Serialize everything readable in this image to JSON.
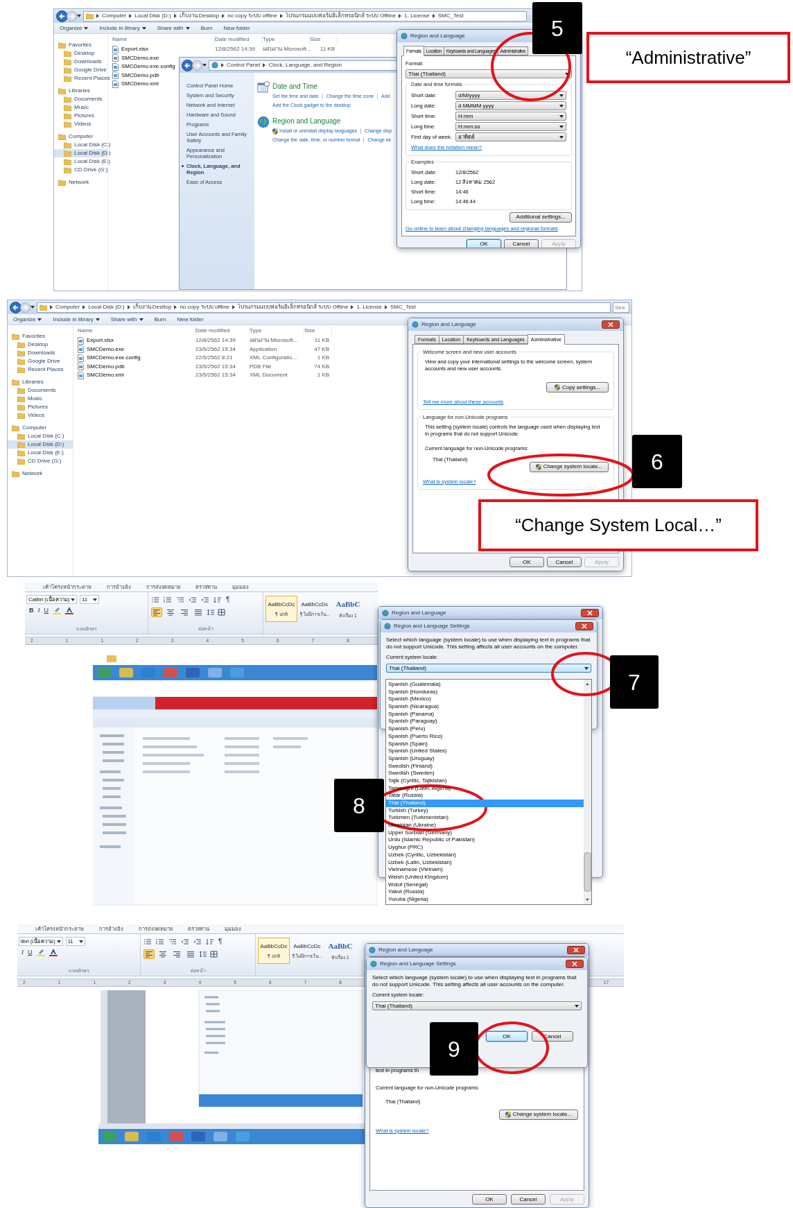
{
  "panel_1": {
    "explorer": {
      "breadcrumb": [
        "Computer",
        "Local Disk (D:)",
        "เก็บงาน Desktop",
        "no copy ระบบ offline",
        "โปรแกรมแบบฟอร์มอิเล็กทรอนิกส์ ระบบ Offline",
        "1. License",
        "SMC_Test"
      ],
      "toolbar": [
        {
          "label": "Organize",
          "menu": true
        },
        {
          "label": "Include in library",
          "menu": true
        },
        {
          "label": "Share with",
          "menu": true
        },
        {
          "label": "Burn",
          "menu": false
        },
        {
          "label": "New folder",
          "menu": false
        }
      ],
      "columns": [
        "Name",
        "Date modified",
        "Type",
        "Size"
      ],
      "nav": [
        {
          "label": "Favorites",
          "kind": "group",
          "selected": false
        },
        {
          "label": "Desktop",
          "kind": "item",
          "selected": false
        },
        {
          "label": "Downloads",
          "kind": "item",
          "selected": false
        },
        {
          "label": "Google Drive",
          "kind": "item",
          "selected": false
        },
        {
          "label": "Recent Places",
          "kind": "item",
          "selected": false
        },
        {
          "label": "Libraries",
          "kind": "group",
          "selected": false
        },
        {
          "label": "Documents",
          "kind": "item",
          "selected": false
        },
        {
          "label": "Music",
          "kind": "item",
          "selected": false
        },
        {
          "label": "Pictures",
          "kind": "item",
          "selected": false
        },
        {
          "label": "Videos",
          "kind": "item",
          "selected": false
        },
        {
          "label": "Computer",
          "kind": "group",
          "selected": false
        },
        {
          "label": "Local Disk (C:)",
          "kind": "item",
          "selected": false
        },
        {
          "label": "Local Disk (D:)",
          "kind": "item",
          "selected": true
        },
        {
          "label": "Local Disk (E:)",
          "kind": "item",
          "selected": false
        },
        {
          "label": "CD Drive (G:)",
          "kind": "item",
          "selected": false
        },
        {
          "label": "Network",
          "kind": "group",
          "selected": false
        }
      ],
      "rows": [
        {
          "name": "Export.xlsx",
          "date": "12/8/2562 14:39",
          "type": "แผ่นงาน Microsoft...",
          "size": "11 KB"
        },
        {
          "name": "SMCDemo.exe"
        },
        {
          "name": "SMCDemo.exe.config"
        },
        {
          "name": "SMCDemo.pdb"
        },
        {
          "name": "SMCDemo.xml"
        }
      ]
    },
    "control_panel": {
      "breadcrumb": [
        "Control Panel",
        "Clock, Language, and Region"
      ],
      "nav": [
        {
          "label": "Control Panel Home",
          "selected": false
        },
        {
          "label": "System and Security",
          "selected": false
        },
        {
          "label": "Network and Internet",
          "selected": false
        },
        {
          "label": "Hardware and Sound",
          "selected": false
        },
        {
          "label": "Programs",
          "selected": false
        },
        {
          "label": "User Accounts and Family Safety",
          "selected": false
        },
        {
          "label": "Appearance and Personalization",
          "selected": false
        },
        {
          "label": "Clock, Language, and Region",
          "selected": true
        },
        {
          "label": "Ease of Access",
          "selected": false
        }
      ],
      "categories": [
        {
          "title": "Date and Time",
          "kind": "calendar",
          "lines": [
            {
              "kind": "plain",
              "links": [
                "Set the time and date",
                "Change the time zone",
                "Add"
              ]
            },
            {
              "kind": "plain",
              "links": [
                "Add the Clock gadget to the desktop"
              ]
            }
          ]
        },
        {
          "title": "Region and Language",
          "kind": "globe",
          "lines": [
            {
              "kind": "shield",
              "links": [
                "Install or uninstall display languages",
                "Change disp"
              ]
            },
            {
              "kind": "plain",
              "links": [
                "Change the date, time, or number format",
                "Change ke"
              ]
            }
          ]
        }
      ]
    },
    "dialog": {
      "title": "Region and Language",
      "tabs": [
        {
          "label": "Formats",
          "selected": true
        },
        {
          "label": "Location",
          "selected": false
        },
        {
          "label": "Keyboards and Languages",
          "selected": false
        },
        {
          "label": "Administrative",
          "selected": false
        }
      ],
      "format_label": "Format:",
      "format": "Thai (Thailand)",
      "group": "Date and time formats",
      "fields": [
        {
          "label": "Short date:",
          "value": "d/M/yyyy"
        },
        {
          "label": "Long date:",
          "value": "d MMMM yyyy"
        },
        {
          "label": "Short time:",
          "value": "H:mm"
        },
        {
          "label": "Long time:",
          "value": "H:mm:ss"
        },
        {
          "label": "First day of week:",
          "value": "อาทิตย์"
        }
      ],
      "notation_link": "What does the notation mean?",
      "examples_title": "Examples",
      "examples": [
        {
          "label": "Short date:",
          "value": "12/8/2562"
        },
        {
          "label": "Long date:",
          "value": "12 สิงหาคม 2562"
        },
        {
          "label": "Short time:",
          "value": "14:46"
        },
        {
          "label": "Long time:",
          "value": "14:46:44"
        }
      ],
      "additional": "Additional settings...",
      "online_link": "Go online to learn about changing languages and regional formats",
      "buttons": [
        {
          "label": "OK",
          "default": true,
          "disabled": false
        },
        {
          "label": "Cancel",
          "default": false,
          "disabled": false
        },
        {
          "label": "Apply",
          "default": false,
          "disabled": true
        }
      ]
    },
    "callout": "5",
    "caption": "“Administrative”"
  },
  "panel_2": {
    "explorer": {
      "breadcrumb": [
        "Computer",
        "Local Disk (D:)",
        "เก็บงาน Desttop",
        "no copy ระบบ offline",
        "โปรแกรมแบบฟอร์มอิเล็กทรอนิกส์ ระบบ Offline",
        "1. License",
        "SMC_Test"
      ],
      "search": "Sea",
      "toolbar": [
        {
          "label": "Organize",
          "menu": true
        },
        {
          "label": "Include in library",
          "menu": true
        },
        {
          "label": "Share with",
          "menu": true
        },
        {
          "label": "Burn",
          "menu": false
        },
        {
          "label": "New folder",
          "menu": false
        }
      ],
      "columns": [
        "Name",
        "Date modified",
        "Type",
        "Size"
      ],
      "nav": [
        {
          "label": "Favorites",
          "kind": "group",
          "selected": false
        },
        {
          "label": "Desktop",
          "kind": "item",
          "selected": false
        },
        {
          "label": "Downloads",
          "kind": "item",
          "selected": false
        },
        {
          "label": "Google Drive",
          "kind": "item",
          "selected": false
        },
        {
          "label": "Recent Places",
          "kind": "item",
          "selected": false
        },
        {
          "label": "Libraries",
          "kind": "group",
          "selected": false
        },
        {
          "label": "Documents",
          "kind": "item",
          "selected": false
        },
        {
          "label": "Music",
          "kind": "item",
          "selected": false
        },
        {
          "label": "Pictures",
          "kind": "item",
          "selected": false
        },
        {
          "label": "Videos",
          "kind": "item",
          "selected": false
        },
        {
          "label": "Computer",
          "kind": "group",
          "selected": false
        },
        {
          "label": "Local Disk (C:)",
          "kind": "item",
          "selected": false
        },
        {
          "label": "Local Disk (D:)",
          "kind": "item",
          "selected": true
        },
        {
          "label": "Local Disk (E:)",
          "kind": "item",
          "selected": false
        },
        {
          "label": "CD Drive (G:)",
          "kind": "item",
          "selected": false
        },
        {
          "label": "Network",
          "kind": "group",
          "selected": false
        }
      ],
      "rows": [
        {
          "name": "Export.xlsx",
          "date": "12/8/2562 14:39",
          "type": "แผ่นงาน Microsoft...",
          "size": "11 KB"
        },
        {
          "name": "SMCDemo.exe",
          "date": "23/5/2562 15:34",
          "type": "Application",
          "size": "47 KB"
        },
        {
          "name": "SMCDemo.exe.config",
          "date": "22/5/2562 8:21",
          "type": "XML Configuratio...",
          "size": "1 KB"
        },
        {
          "name": "SMCDemo.pdb",
          "date": "23/5/2562 15:34",
          "type": "PDB File",
          "size": "74 KB"
        },
        {
          "name": "SMCDemo.xml",
          "date": "23/5/2562 15:34",
          "type": "XML Document",
          "size": "1 KB"
        }
      ]
    },
    "dialog": {
      "title": "Region and Language",
      "tabs": [
        {
          "label": "Formats",
          "selected": false
        },
        {
          "label": "Location",
          "selected": false
        },
        {
          "label": "Keyboards and Languages",
          "selected": false
        },
        {
          "label": "Administrative",
          "selected": true
        }
      ],
      "welcome": {
        "title": "Welcome screen and new user accounts",
        "text": "View and copy your international settings to the welcome screen, system accounts and new user accounts.",
        "button": "Copy settings...",
        "link": "Tell me more about these accounts"
      },
      "non_unicode": {
        "title": "Language for non-Unicode programs",
        "text": "This setting (system locale) controls the language used when displaying text in programs that do not support Unicode.",
        "current_label": "Current language for non-Unicode programs:",
        "current": "Thai (Thailand)",
        "button": "Change system locale...",
        "link": "What is system locale?"
      },
      "buttons": [
        {
          "label": "OK",
          "default": false,
          "disabled": false
        },
        {
          "label": "Cancel",
          "default": false,
          "disabled": false
        },
        {
          "label": "Apply",
          "default": false,
          "disabled": true
        }
      ]
    },
    "callout": "6",
    "caption": "“Change System Local…”"
  },
  "panel_3": {
    "word": {
      "tabs": [
        "เค้าโครงหน้ากระดาษ",
        "การอ้างอิง",
        "การส่งจดหมาย",
        "ตรวจทาน",
        "มุมมอง"
      ],
      "font": "Calibri (เนื้อความ)",
      "size": "11",
      "format_glyphs": [
        {
          "glyph": "B",
          "kind": "bold"
        },
        {
          "glyph": "I",
          "kind": "italic"
        },
        {
          "glyph": "U",
          "kind": "underline"
        }
      ],
      "paragraph_glyph": "¶",
      "align_buttons": [
        {
          "kind": "left",
          "selected": true
        },
        {
          "kind": "center",
          "selected": false
        },
        {
          "kind": "right",
          "selected": false
        },
        {
          "kind": "justify",
          "selected": false
        }
      ],
      "styles": [
        {
          "sample": "AaBbCcDc",
          "name": "¶ ปกติ",
          "kind": "normal",
          "selected": true
        },
        {
          "sample": "AaBbCcDc",
          "name": "¶ ไม่มีการเว้น...",
          "kind": "normal",
          "selected": false
        },
        {
          "sample": "AaBbC",
          "name": "หัวเรื่อง 1",
          "kind": "heading",
          "selected": false
        }
      ],
      "groups": [
        "แบบอักษร",
        "ย่อหน้า"
      ],
      "ruler": [
        "2",
        "1",
        "1",
        "2",
        "3",
        "4",
        "5",
        "6",
        "7",
        "8"
      ]
    },
    "back_dialog": {
      "title": "Region and Language"
    },
    "settings": {
      "title": "Region and Language Settings",
      "text": "Select which language (system locale) to use when displaying text in programs that do not support Unicode. This setting affects all user accounts on the computer.",
      "label": "Current system locale:",
      "value": "Thai (Thailand)",
      "expanded": true,
      "options": [
        {
          "label": "Spanish (Guatemala)",
          "selected": false
        },
        {
          "label": "Spanish (Honduras)",
          "selected": false
        },
        {
          "label": "Spanish (Mexico)",
          "selected": false
        },
        {
          "label": "Spanish (Nicaragua)",
          "selected": false
        },
        {
          "label": "Spanish (Panama)",
          "selected": false
        },
        {
          "label": "Spanish (Paraguay)",
          "selected": false
        },
        {
          "label": "Spanish (Peru)",
          "selected": false
        },
        {
          "label": "Spanish (Puerto Rico)",
          "selected": false
        },
        {
          "label": "Spanish (Spain)",
          "selected": false
        },
        {
          "label": "Spanish (United States)",
          "selected": false
        },
        {
          "label": "Spanish (Uruguay)",
          "selected": false
        },
        {
          "label": "Swedish (Finland)",
          "selected": false
        },
        {
          "label": "Swedish (Sweden)",
          "selected": false
        },
        {
          "label": "Tajik (Cyrillic, Tajikistan)",
          "selected": false
        },
        {
          "label": "Tamazight (Latin, Algeria)",
          "selected": false
        },
        {
          "label": "Tatar (Russia)",
          "selected": false
        },
        {
          "label": "Thai (Thailand)",
          "selected": true
        },
        {
          "label": "Turkish (Turkey)",
          "selected": false
        },
        {
          "label": "Turkmen (Turkmenistan)",
          "selected": false
        },
        {
          "label": "Ukrainian (Ukraine)",
          "selected": false
        },
        {
          "label": "Upper Sorbian (Germany)",
          "selected": false
        },
        {
          "label": "Urdu (Islamic Republic of Pakistan)",
          "selected": false
        },
        {
          "label": "Uyghur (PRC)",
          "selected": false
        },
        {
          "label": "Uzbek (Cyrillic, Uzbekistan)",
          "selected": false
        },
        {
          "label": "Uzbek (Latin, Uzbekistan)",
          "selected": false
        },
        {
          "label": "Vietnamese (Vietnam)",
          "selected": false
        },
        {
          "label": "Welsh (United Kingdom)",
          "selected": false
        },
        {
          "label": "Wolof (Senegal)",
          "selected": false
        },
        {
          "label": "Yakut (Russia)",
          "selected": false
        },
        {
          "label": "Yoruba (Nigeria)",
          "selected": false
        }
      ]
    },
    "callouts": [
      "7",
      "8"
    ]
  },
  "panel_4": {
    "word": {
      "tabs": [
        "เค้าโครงหน้ากระดาษ",
        "การอ้างอิง",
        "การส่งจดหมาย",
        "ตรวจทาน",
        "มุมมอง"
      ],
      "font": "libri (เนื้อความ)",
      "size": "11",
      "format_glyphs": [
        {
          "glyph": "I",
          "kind": "italic"
        },
        {
          "glyph": "U",
          "kind": "underline"
        }
      ],
      "paragraph_glyph": "¶",
      "align_buttons": [
        {
          "kind": "left",
          "selected": true
        },
        {
          "kind": "center",
          "selected": false
        },
        {
          "kind": "right",
          "selected": false
        },
        {
          "kind": "justify",
          "selected": false
        }
      ],
      "styles": [
        {
          "sample": "AaBbCcDc",
          "name": "¶ ปกติ",
          "kind": "normal",
          "selected": true
        },
        {
          "sample": "AaBbCcDc",
          "name": "¶ ไม่มีการเว้น...",
          "kind": "normal",
          "selected": false
        },
        {
          "sample": "AaBbC",
          "name": "หัวเรื่อง 1",
          "kind": "heading",
          "selected": false
        }
      ],
      "groups": [
        "แบบอักษร",
        "ย่อหน้า"
      ],
      "ruler": [
        "2",
        "1",
        "1",
        "2",
        "3",
        "4",
        "5",
        "6",
        "7",
        "8"
      ],
      "ruler_end": "17"
    },
    "back_dialog": {
      "title": "Region and Language",
      "partial_text": "text in programs th",
      "current_label": "Current language for non-Unicode programs:",
      "current": "Thai (Thailand)",
      "button": "Change system locale...",
      "link": "What is system locale?",
      "buttons": [
        {
          "label": "OK",
          "default": false,
          "disabled": false
        },
        {
          "label": "Cancel",
          "default": false,
          "disabled": false
        },
        {
          "label": "Apply",
          "default": false,
          "disabled": true
        }
      ]
    },
    "settings": {
      "title": "Region and Language Settings",
      "text": "Select which language (system locale) to use when displaying text in programs that do not support Unicode. This setting affects all user accounts on the computer.",
      "label": "Current system locale:",
      "value": "Thai (Thailand)",
      "expanded": false,
      "buttons": [
        {
          "label": "OK",
          "default": true,
          "disabled": false
        },
        {
          "label": "Cancel",
          "default": false,
          "disabled": false
        }
      ]
    },
    "callout": "9"
  }
}
